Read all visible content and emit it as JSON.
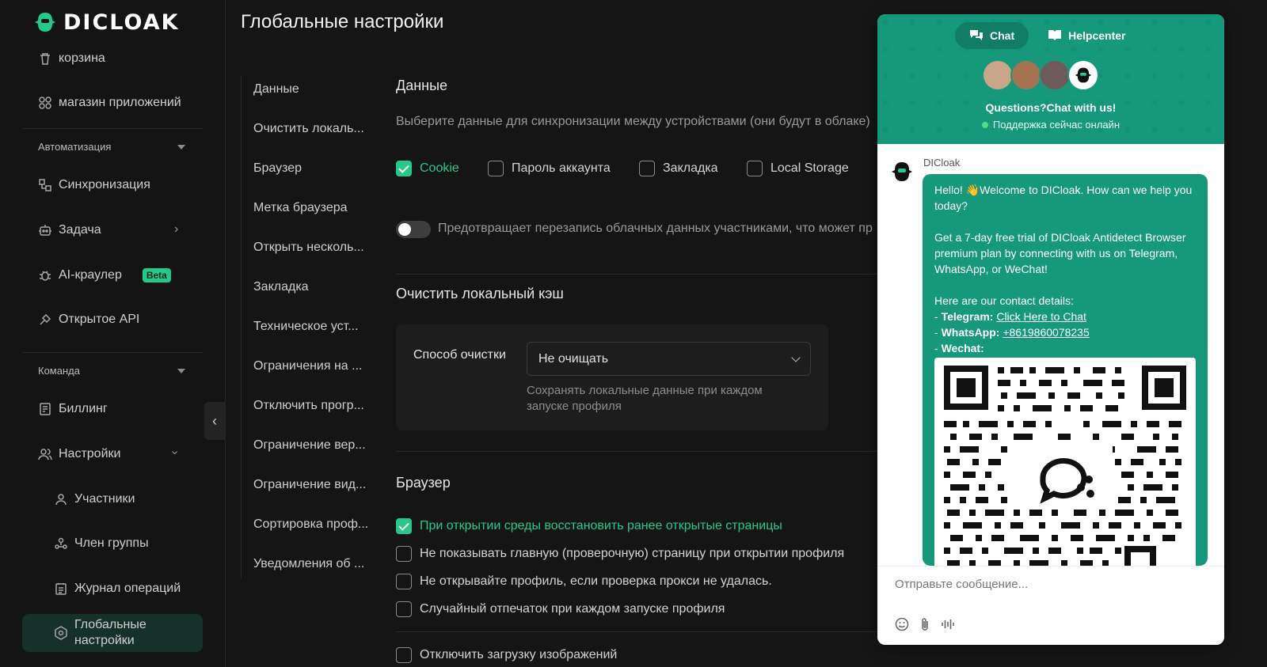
{
  "app": {
    "logo_text": "DICLOAK",
    "page_title": "Глобальные настройки"
  },
  "sidebar": {
    "items": [
      {
        "label": "корзина",
        "icon": "trash-icon"
      },
      {
        "label": "магазин приложений",
        "icon": "apps-icon"
      },
      {
        "label": "Синхронизация",
        "icon": "sync-icon"
      },
      {
        "label": "Задача",
        "icon": "robot-icon"
      },
      {
        "label": "AI-краулер",
        "icon": "bug-icon",
        "badge": "Beta"
      },
      {
        "label": "Открытое API",
        "icon": "api-icon"
      },
      {
        "label": "Биллинг",
        "icon": "billing-icon"
      },
      {
        "label": "Настройки",
        "icon": "users-icon"
      },
      {
        "label": "Участники",
        "icon": "member-icon"
      },
      {
        "label": "Член группы",
        "icon": "group-icon"
      },
      {
        "label": "Журнал операций",
        "icon": "log-icon"
      },
      {
        "label": "Глобальные настройки",
        "icon": "settings-icon"
      }
    ],
    "sections": {
      "automation": "Автоматизация",
      "team": "Команда"
    }
  },
  "subnav": [
    "Данные",
    "Очистить локаль...",
    "Браузер",
    "Метка браузера",
    "Открыть несколь...",
    "Закладка",
    "Техническое уст...",
    "Ограничения на ...",
    "Отключить прогр...",
    "Ограничение вер...",
    "Ограничение вид...",
    "Сортировка проф...",
    "Уведомления об ..."
  ],
  "data_section": {
    "title": "Данные",
    "description": "Выберите данные для синхронизации между устройствами (они будут в облаке)",
    "options": [
      {
        "label": "Cookie",
        "checked": true
      },
      {
        "label": "Пароль аккаунта",
        "checked": false
      },
      {
        "label": "Закладка",
        "checked": false
      },
      {
        "label": "Local Storage",
        "checked": false
      }
    ],
    "toggle_text": "Предотвращает перезапись облачных данных участниками, что может пр",
    "toggle_on": false
  },
  "cache_section": {
    "title": "Очистить локальный кэш",
    "label": "Способ очистки",
    "select_value": "Не очищать",
    "hint_line1": "Сохранять локальные данные при каждом",
    "hint_line2": "запуске профиля"
  },
  "browser_section": {
    "title": "Браузер",
    "options": [
      {
        "label": "При открытии среды восстановить ранее открытые страницы",
        "checked": true
      },
      {
        "label": "Не показывать главную (проверочную) страницу при открытии профиля",
        "checked": false
      },
      {
        "label": "Не открывайте профиль, если проверка прокси не удалась.",
        "checked": false
      },
      {
        "label": "Случайный отпечаток при каждом запуске профиля",
        "checked": false
      },
      {
        "label": "Отключить загрузку изображений",
        "checked": false
      }
    ]
  },
  "chat": {
    "tab_chat": "Chat",
    "tab_help": "Helpcenter",
    "title": "Questions?Chat with us!",
    "online": "Поддержка сейчас онлайн",
    "bot_name": "DICloak",
    "msg_greeting": "Hello! 👋Welcome to DICloak. How can we help you today?",
    "msg_trial": "Get a 7-day free trial of DICloak Antidetect Browser premium plan by connecting with us on Telegram, WhatsApp, or WeChat!",
    "msg_contacts": "Here are our contact details:",
    "telegram_label": "Telegram:",
    "telegram_link": "Click Here to Chat",
    "whatsapp_label": "WhatsApp:",
    "whatsapp_link": "+8619860078235",
    "wechat_label": "Wechat:",
    "input_placeholder": "Отправьте сообщение..."
  },
  "colors": {
    "accent": "#25c98a",
    "chat_brand": "#15997a",
    "background": "#151515"
  }
}
